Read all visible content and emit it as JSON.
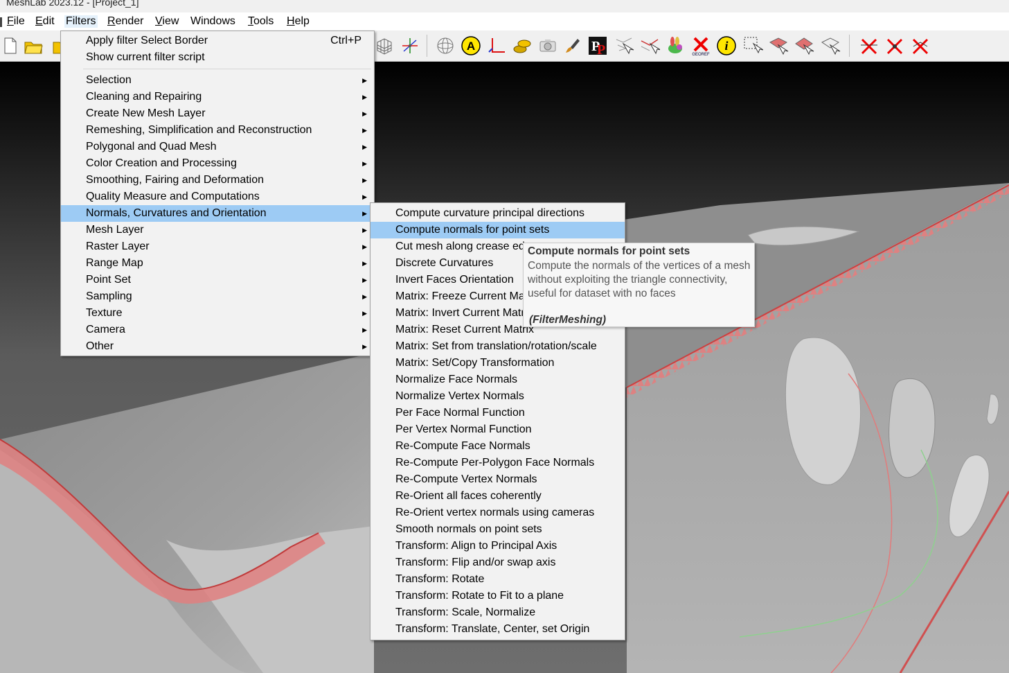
{
  "window": {
    "title": "MeshLab 2023.12 - [Project_1]"
  },
  "menubar": {
    "items": [
      {
        "key": "F",
        "rest": "ile",
        "name": "file"
      },
      {
        "key": "E",
        "rest": "dit",
        "name": "edit"
      },
      {
        "key": "",
        "rest": "Filters",
        "name": "filters"
      },
      {
        "key": "R",
        "rest": "ender",
        "name": "render"
      },
      {
        "key": "V",
        "rest": "iew",
        "name": "view"
      },
      {
        "key": "",
        "rest": "Windows",
        "name": "windows"
      },
      {
        "key": "T",
        "rest": "ools",
        "name": "tools"
      },
      {
        "key": "H",
        "rest": "elp",
        "name": "help"
      }
    ]
  },
  "toolbar": {
    "icons": [
      "new-project-icon",
      "open-project-icon",
      "open-folder-icon",
      "grid-icon",
      "axis-icon",
      "sphere-icon",
      "annotation-a-icon",
      "axis-2d-icon",
      "coin-icon",
      "camera-icon",
      "paint-brush-icon",
      "pp-points-icon",
      "select-vertex-icon",
      "select-edges-icon",
      "bunny-icon",
      "georef-icon",
      "info-icon",
      "select-rect-icon",
      "select-faces-icon",
      "select-connected-icon",
      "select-region-icon",
      "delete-face-icon",
      "delete-vertex-icon",
      "delete-selected-icon"
    ],
    "georef_label": "GEOREF"
  },
  "filters_menu": {
    "apply_filter": "Apply filter Select Border",
    "apply_shortcut": "Ctrl+P",
    "show_script": "Show current filter script",
    "categories": [
      "Selection",
      "Cleaning and Repairing",
      "Create New Mesh Layer",
      "Remeshing, Simplification and Reconstruction",
      "Polygonal and Quad Mesh",
      "Color Creation and Processing",
      "Smoothing, Fairing and Deformation",
      "Quality Measure and Computations",
      "Normals, Curvatures and Orientation",
      "Mesh Layer",
      "Raster Layer",
      "Range Map",
      "Point Set",
      "Sampling",
      "Texture",
      "Camera",
      "Other"
    ],
    "highlighted_category": "Normals, Curvatures and Orientation"
  },
  "normals_submenu": {
    "items": [
      "Compute curvature principal directions",
      "Compute normals for point sets",
      "Cut mesh along crease edges",
      "Discrete Curvatures",
      "Invert Faces Orientation",
      "Matrix: Freeze Current Matrix",
      "Matrix: Invert Current Matrix",
      "Matrix: Reset Current Matrix",
      "Matrix: Set from translation/rotation/scale",
      "Matrix: Set/Copy Transformation",
      "Normalize Face Normals",
      "Normalize Vertex Normals",
      "Per Face Normal Function",
      "Per Vertex Normal Function",
      "Re-Compute Face Normals",
      "Re-Compute Per-Polygon Face Normals",
      "Re-Compute Vertex Normals",
      "Re-Orient all faces coherently",
      "Re-Orient vertex normals using cameras",
      "Smooth normals on point sets",
      "Transform: Align to Principal Axis",
      "Transform: Flip and/or swap axis",
      "Transform: Rotate",
      "Transform: Rotate to Fit to a plane",
      "Transform: Scale, Normalize",
      "Transform: Translate, Center, set Origin"
    ],
    "highlighted_item": "Compute normals for point sets"
  },
  "tooltip": {
    "title": "Compute normals for point sets",
    "description": "Compute the normals of the vertices of a mesh without exploiting the triangle connectivity, useful for dataset with no faces",
    "plugin": "(FilterMeshing)"
  },
  "colors": {
    "menu_bg": "#f2f2f2",
    "highlight": "#9dcbf4",
    "border_red": "#e07a7a",
    "mesh_gray": "#a8a8a8"
  }
}
